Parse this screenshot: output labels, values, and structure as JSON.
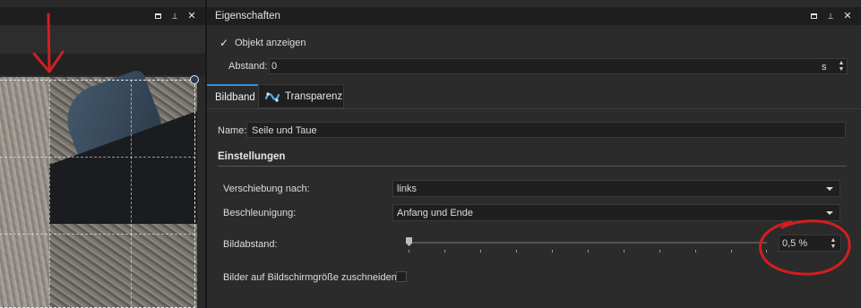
{
  "left_panel": {
    "window_buttons": {
      "restore": "",
      "pin": "",
      "close": "✕"
    }
  },
  "properties": {
    "title": "Eigenschaften",
    "window_buttons": {
      "close": "✕"
    },
    "show_object": {
      "label": "Objekt anzeigen",
      "checked": true
    },
    "distance": {
      "label": "Abstand:",
      "value": "0",
      "unit": "s"
    },
    "tabs": [
      {
        "label": "Bildband",
        "active": true
      },
      {
        "label": "Transparenz",
        "active": false
      }
    ],
    "name": {
      "label": "Name:",
      "value": "Seile und Taue"
    },
    "settings": {
      "header": "Einstellungen",
      "shift": {
        "label": "Verschiebung nach:",
        "value": "links"
      },
      "acceleration": {
        "label": "Beschleunigung:",
        "value": "Anfang und Ende"
      },
      "spacing": {
        "label": "Bildabstand:",
        "value": "0,5 %",
        "slider_fraction": 0.005
      },
      "crop": {
        "label": "Bilder auf Bildschirmgröße zuschneiden",
        "checked": false
      }
    }
  },
  "colors": {
    "accent": "#2e8fd6",
    "annotation": "#d11f1f"
  },
  "icons": {
    "check": "check-icon",
    "spin": "spin-arrows-icon",
    "dropdown": "chevron-down-icon",
    "transparency": "wave-icon"
  }
}
